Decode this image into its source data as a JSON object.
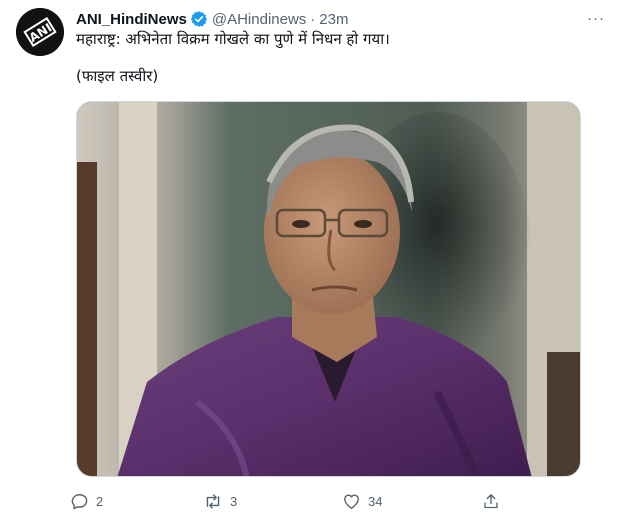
{
  "author": {
    "display_name": "ANI_HindiNews",
    "handle": "@AHindinews",
    "separator": "·",
    "timestamp": "23m",
    "avatar_logo_text": "ANI",
    "verified_icon": "verified-badge-icon"
  },
  "tweet": {
    "text_line1": "महाराष्ट्र: अभिनेता विक्रम गोखले का पुणे में निधन हो गया।",
    "text_line2": "(फाइल तस्वीर)"
  },
  "more_label": "···",
  "actions": {
    "reply_count": "2",
    "retweet_count": "3",
    "like_count": "34",
    "share_count": ""
  },
  "colors": {
    "text": "#0f1419",
    "secondary": "#536471",
    "verified": "#1d9bf0",
    "border": "#cfd9de"
  }
}
